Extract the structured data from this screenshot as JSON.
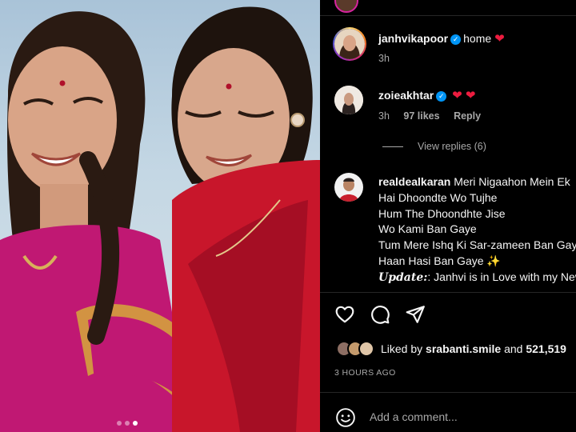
{
  "post": {
    "carousel": {
      "slide_count": 3,
      "active_index": 2
    },
    "caption_comment": {
      "username": "janhvikapoor",
      "verified": true,
      "text": "home",
      "emoji": "❤",
      "time": "3h"
    },
    "comments": [
      {
        "username": "zoieakhtar",
        "verified": true,
        "emoji": "❤ ❤",
        "time": "3h",
        "likes": "97 likes",
        "reply_label": "Reply",
        "view_replies": "View replies (6)"
      },
      {
        "username": "realdealkaran",
        "lines": [
          "Meri Nigaahon Mein Ek",
          "Hai Dhoondte Wo Tujhe",
          "Hum The Dhoondhte Jise",
          "Wo Kami Ban Gaye",
          "Tum Mere Ishq Ki Sar-zameen Ban Gaye",
          "Haan Hasi Ban Gaye ✨"
        ],
        "update_label": "Update:",
        "update_text": ": Janhvi is in Love with my New"
      }
    ],
    "actions": {
      "like_icon": "heart-icon",
      "comment_icon": "comment-icon",
      "share_icon": "share-icon"
    },
    "likes_summary": {
      "prefix": "Liked by",
      "user": "srabanti.smile",
      "connector": "and",
      "count": "521,519"
    },
    "time_ago": "3 HOURS AGO",
    "add_comment_placeholder": "Add a comment..."
  },
  "colors": {
    "background": "#000000",
    "text": "#f5f5f5",
    "muted": "#a8a8a8",
    "verified": "#0095f6",
    "heart": "#ed1c3f"
  }
}
